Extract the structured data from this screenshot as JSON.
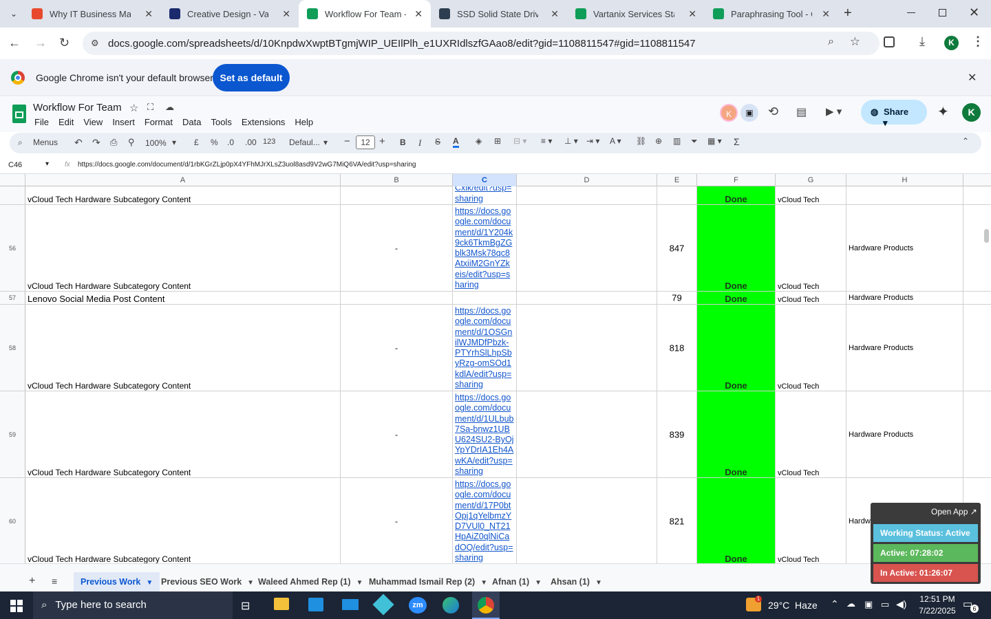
{
  "browser": {
    "tabs": [
      {
        "title": "Why IT Business Manag",
        "favicon_color": "#e8492d",
        "active": false
      },
      {
        "title": "Creative Design - Vartan",
        "favicon_color": "#1a2a6c",
        "active": false
      },
      {
        "title": "Workflow For Team - Go",
        "favicon_color": "#0f9d58",
        "active": true
      },
      {
        "title": "SSD Solid State Drive Pr",
        "favicon_color": "#2d3e50",
        "active": false
      },
      {
        "title": "Vartanix Services Stack",
        "favicon_color": "#0f9d58",
        "active": false
      },
      {
        "title": "Paraphrasing Tool - Qui",
        "favicon_color": "#0f9d58",
        "active": false
      }
    ],
    "new_tab": "+",
    "url": "docs.google.com/spreadsheets/d/10KnpdwXwptBTgmjWIP_UEIlPlh_e1UXRIdlszfGAao8/edit?gid=1108811547#gid=1108811547",
    "profile_initial": "K",
    "infobar_text": "Google Chrome isn't your default browser",
    "infobar_button": "Set as default"
  },
  "doc": {
    "title": "Workflow For Team",
    "menus": [
      "File",
      "Edit",
      "View",
      "Insert",
      "Format",
      "Data",
      "Tools",
      "Extensions",
      "Help"
    ],
    "share_label": "Share",
    "avatar_k": "K",
    "profile_initial": "K"
  },
  "toolbar": {
    "menus_label": "Menus",
    "zoom": "100%",
    "currency": "£",
    "percent": "%",
    "dec_minus": ".0",
    "dec_plus": ".00",
    "num_format": "123",
    "font": "Defaul...",
    "font_size": "12",
    "bold": "B",
    "italic": "I",
    "sigma": "Σ"
  },
  "formula_bar": {
    "cell_ref": "C46",
    "fx": "fx",
    "formula": "https://docs.google.com/document/d/1rbKGrZLjp0pX4YFhMJrXLsZ3uol8asd9V2wG7MiQ6VA/edit?usp=sharing"
  },
  "columns": [
    "A",
    "B",
    "C",
    "D",
    "E",
    "F",
    "G",
    "H"
  ],
  "rows": [
    {
      "num": "",
      "a": "vCloud Tech Hardware Subcategory Content",
      "b": "",
      "c": "Cxlk/edit?usp=sharing",
      "d": "",
      "e": "",
      "f": "Done",
      "g": "vCloud Tech",
      "h": ""
    },
    {
      "num": "56",
      "a": "vCloud Tech Hardware Subcategory Content",
      "b": "-",
      "c": "https://docs.google.com/document/d/1Y204k9ck6TkmBgZGblk3Msk78qc8AtxiiM2GnYZkeis/edit?usp=sharing",
      "d": "",
      "e": "847",
      "f": "Done",
      "g": "vCloud Tech",
      "h": "Hardware Products"
    },
    {
      "num": "57",
      "a": "Lenovo Social Media Post Content",
      "b": "",
      "c": "",
      "d": "",
      "e": "79",
      "f": "Done",
      "g": "vCloud Tech",
      "h": "Hardware Products"
    },
    {
      "num": "58",
      "a": "vCloud Tech Hardware Subcategory Content",
      "b": "-",
      "c": "https://docs.google.com/document/d/1OSGnilWJMDfPbzk-PTYrhSlLhpSbyRzg-omSOd1kdlA/edit?usp=sharing",
      "d": "",
      "e": "818",
      "f": "Done",
      "g": "vCloud Tech",
      "h": "Hardware Products"
    },
    {
      "num": "59",
      "a": "vCloud Tech Hardware Subcategory Content",
      "b": "-",
      "c": "https://docs.google.com/document/d/1ULbub7Sa-bnwz1UBU624SU2-ByOjYpYDrIA1Eh4AwKA/edit?usp=sharing",
      "d": "",
      "e": "839",
      "f": "Done",
      "g": "vCloud Tech",
      "h": "Hardware Products"
    },
    {
      "num": "60",
      "a": "vCloud Tech Hardware Subcategory Content",
      "b": "-",
      "c": "https://docs.google.com/document/d/17P0btOpj1qYelbmzYD7VUl0_NT21HpAiZ0qlNiCadOQ/edit?usp=sharing",
      "d": "",
      "e": "821",
      "f": "Done",
      "g": "vCloud Tech",
      "h": "Hardware Products"
    }
  ],
  "sheet_tabs": [
    "Previous Work",
    "Previous SEO Work",
    "Waleed Ahmed Rep (1)",
    "Muhammad Ismail Rep (2)",
    "Afnan (1)",
    "Ahsan (1)"
  ],
  "widget": {
    "open_app": "Open App ↗",
    "status": "Working Status: Active",
    "active": "Active: 07:28:02",
    "inactive": "In Active: 01:26:07",
    "status_color": "#5bc0de",
    "active_color": "#5cb85c",
    "inactive_color": "#d9534f"
  },
  "taskbar": {
    "search_placeholder": "Type here to search",
    "weather": "29°C  Haze",
    "time": "12:51 PM",
    "date": "7/22/2025",
    "notif_count": "6",
    "weather_badge": "1"
  }
}
